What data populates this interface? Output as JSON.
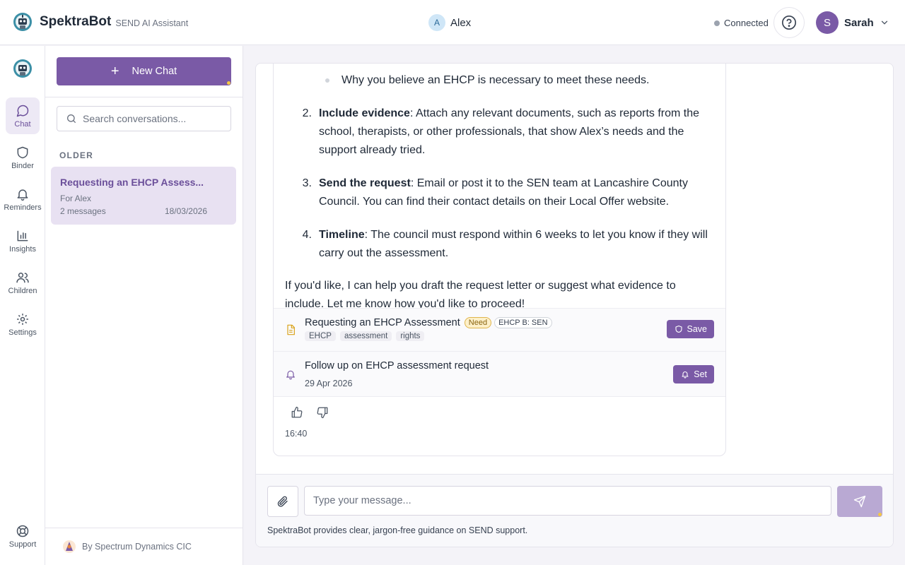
{
  "header": {
    "brand": "SpektraBot",
    "brand_sub": "SEND AI Assistant",
    "child_initial": "A",
    "child_name": "Alex",
    "connection_status": "Connected",
    "user_initial": "S",
    "user_name": "Sarah"
  },
  "rail": {
    "items": [
      {
        "label": "Chat",
        "icon": "chat-bubble-icon",
        "active": true
      },
      {
        "label": "Binder",
        "icon": "shield-icon"
      },
      {
        "label": "Reminders",
        "icon": "bell-icon"
      },
      {
        "label": "Insights",
        "icon": "bar-chart-icon"
      },
      {
        "label": "Children",
        "icon": "users-icon"
      },
      {
        "label": "Settings",
        "icon": "gear-icon"
      }
    ],
    "support_label": "Support"
  },
  "sidebar": {
    "new_chat_label": "New Chat",
    "search_placeholder": "Search conversations...",
    "section_label": "OLDER",
    "conversations": [
      {
        "title": "Requesting an EHCP Assess...",
        "for": "For Alex",
        "messages": "2 messages",
        "date": "18/03/2026"
      }
    ],
    "footer": "By Spectrum Dynamics CIC"
  },
  "message": {
    "bullet": "Why you believe an EHCP is necessary to meet these needs.",
    "steps": [
      {
        "num": "2.",
        "bold": "Include evidence",
        "text": ": Attach any relevant documents, such as reports from the school, therapists, or other professionals, that show Alex’s needs and the support already tried."
      },
      {
        "num": "3.",
        "bold": "Send the request",
        "text": ": Email or post it to the SEN team at Lancashire County Council. You can find their contact details on their Local Offer website."
      },
      {
        "num": "4.",
        "bold": "Timeline",
        "text": ": The council must respond within 6 weeks to let you know if they will carry out the assessment."
      }
    ],
    "closing": "If you'd like, I can help you draft the request letter or suggest what evidence to include. Let me know how you'd like to proceed!",
    "document": {
      "title": "Requesting an EHCP Assessment",
      "badge_need": "Need",
      "badge_section": "EHCP B: SEN",
      "tags": [
        "EHCP",
        "assessment",
        "rights"
      ],
      "button": "Save"
    },
    "reminder": {
      "title": "Follow up on EHCP assessment request",
      "date": "29 Apr 2026",
      "button": "Set"
    },
    "time": "16:40"
  },
  "composer": {
    "placeholder": "Type your message...",
    "disclaimer": "SpektraBot provides clear, jargon-free guidance on SEND support."
  },
  "colors": {
    "accent": "#7a5aa6",
    "accent_light": "#e8e1f2",
    "send_disabled": "#b9a9d3",
    "need_badge": "#fdf0c9"
  }
}
